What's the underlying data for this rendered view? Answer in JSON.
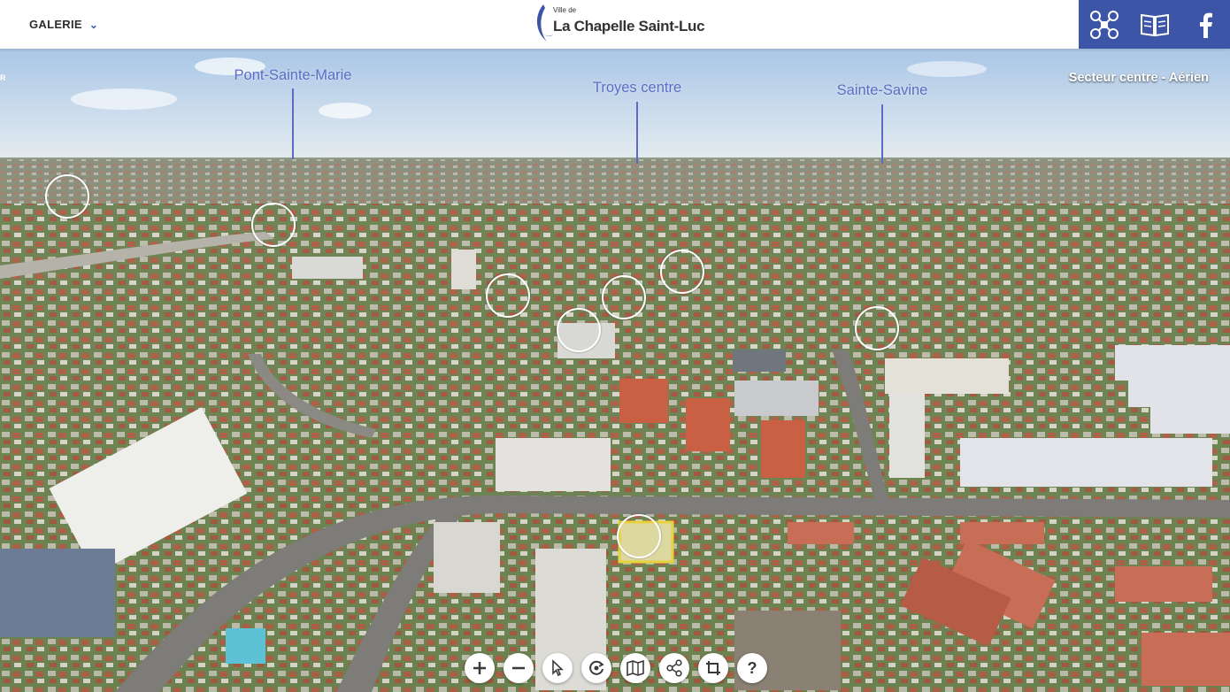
{
  "header": {
    "gallery_label": "GALERIE",
    "logo_prefix": "Ville de",
    "logo_name": "La Chapelle Saint-Luc",
    "icons": [
      "drone-icon",
      "book-icon",
      "facebook-icon"
    ]
  },
  "panorama": {
    "sector_label": "Secteur centre - Aérien",
    "places": [
      {
        "name": "Pont-Sainte-Marie"
      },
      {
        "name": "Troyes centre"
      },
      {
        "name": "Sainte-Savine"
      }
    ],
    "hotspot_count": 10
  },
  "toolbar": {
    "help_label": "?",
    "items": [
      "zoom-in-icon",
      "zoom-out-icon",
      "pointer-icon",
      "autorotate-icon",
      "map-icon",
      "share-icon",
      "fullscreen-icon",
      "help-icon"
    ]
  },
  "colors": {
    "brand_blue": "#3d55a6",
    "label_blue": "#5a6cc4"
  }
}
